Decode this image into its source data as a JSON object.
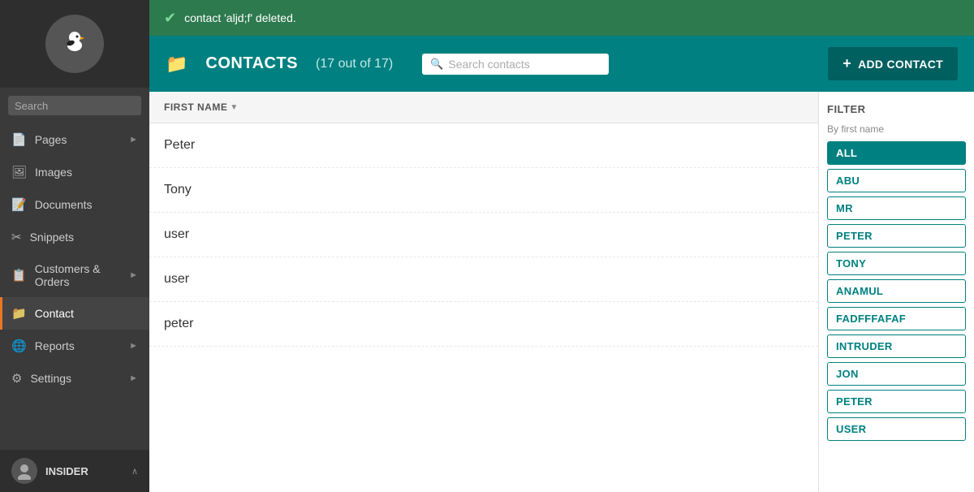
{
  "notification": {
    "message": "contact 'aljd;f' deleted."
  },
  "header": {
    "icon": "📁",
    "title": "CONTACTS",
    "count": "(17 out of 17)",
    "search_placeholder": "Search contacts",
    "add_button": "ADD CONTACT"
  },
  "sidebar": {
    "search_placeholder": "Search",
    "nav_items": [
      {
        "label": "Pages",
        "icon": "📄",
        "arrow": true,
        "active": false
      },
      {
        "label": "Images",
        "icon": "🖼",
        "arrow": false,
        "active": false
      },
      {
        "label": "Documents",
        "icon": "📝",
        "arrow": false,
        "active": false
      },
      {
        "label": "Snippets",
        "icon": "✂",
        "arrow": false,
        "active": false
      },
      {
        "label": "Customers & Orders",
        "icon": "📋",
        "arrow": true,
        "active": false
      },
      {
        "label": "Contact",
        "icon": "📁",
        "arrow": false,
        "active": true
      },
      {
        "label": "Reports",
        "icon": "🌐",
        "arrow": true,
        "active": false
      },
      {
        "label": "Settings",
        "icon": "⚙",
        "arrow": true,
        "active": false
      }
    ],
    "user": {
      "name": "INSIDER",
      "chevron": "∧"
    }
  },
  "contacts_table": {
    "column_header": "FIRST NAME",
    "rows": [
      {
        "name": "Peter"
      },
      {
        "name": "Tony"
      },
      {
        "name": "user"
      },
      {
        "name": "user"
      },
      {
        "name": "peter"
      }
    ]
  },
  "filter": {
    "title": "FILTER",
    "subtitle": "By first name",
    "buttons": [
      {
        "label": "ALL",
        "active": true
      },
      {
        "label": "ABU",
        "active": false
      },
      {
        "label": "MR",
        "active": false
      },
      {
        "label": "PETER",
        "active": false
      },
      {
        "label": "TONY",
        "active": false
      },
      {
        "label": "ANAMUL",
        "active": false
      },
      {
        "label": "FADFFFAFAF",
        "active": false
      },
      {
        "label": "INTRUDER",
        "active": false
      },
      {
        "label": "JON",
        "active": false
      },
      {
        "label": "PETER",
        "active": false
      },
      {
        "label": "USER",
        "active": false
      }
    ]
  }
}
